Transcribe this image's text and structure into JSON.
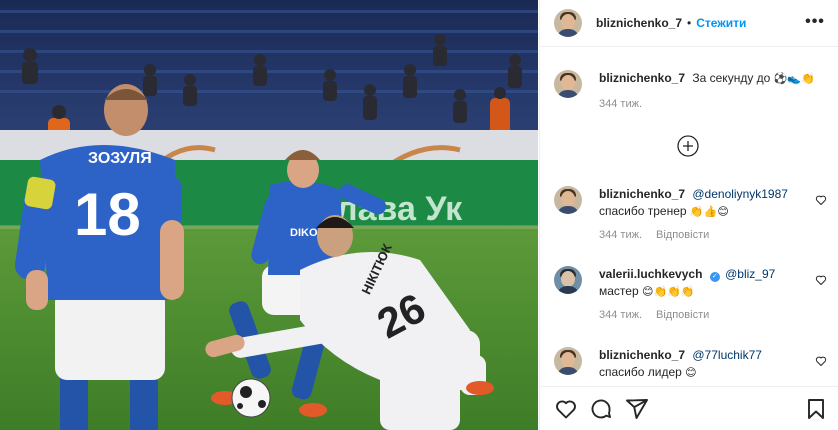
{
  "post": {
    "username": "bliznichenko_7",
    "follow_label": "Стежити",
    "separator": "•",
    "caption": {
      "username": "bliznichenko_7",
      "text": "За секунду до",
      "emojis": "⚽👟👏",
      "time": "344 тиж."
    },
    "photo": {
      "jersey_left_name": "ЗОЗУЛЯ",
      "jersey_left_number": "18",
      "jersey_right_name": "НІКІТЮК",
      "jersey_right_number": "26",
      "board_text": "лава Ук",
      "sponsor": "DIKO"
    }
  },
  "comments": [
    {
      "username": "bliznichenko_7",
      "mention": "@denoliynyk1987",
      "text": "спасибо тренер",
      "emojis": "👏👍😊",
      "time": "344 тиж.",
      "reply_label": "Відповісти"
    },
    {
      "username": "valerii.luchkevych",
      "verified": true,
      "mention": "@bliz_97",
      "text": "мастер",
      "emojis": "😊👏👏👏",
      "time": "344 тиж.",
      "reply_label": "Відповісти"
    },
    {
      "username": "bliznichenko_7",
      "mention": "@77luchik77",
      "text": "спасибо лидер",
      "emojis": "😊"
    }
  ],
  "icons": {
    "more": "more-options-icon",
    "load_more": "plus-circle-icon",
    "like": "heart-icon",
    "comment": "comment-icon",
    "share": "share-icon",
    "save": "bookmark-icon"
  },
  "colors": {
    "follow": "#0095f6",
    "text": "#262626",
    "muted": "#8e8e8e",
    "border": "#efefef",
    "kit_blue": "#2a5fc4"
  }
}
